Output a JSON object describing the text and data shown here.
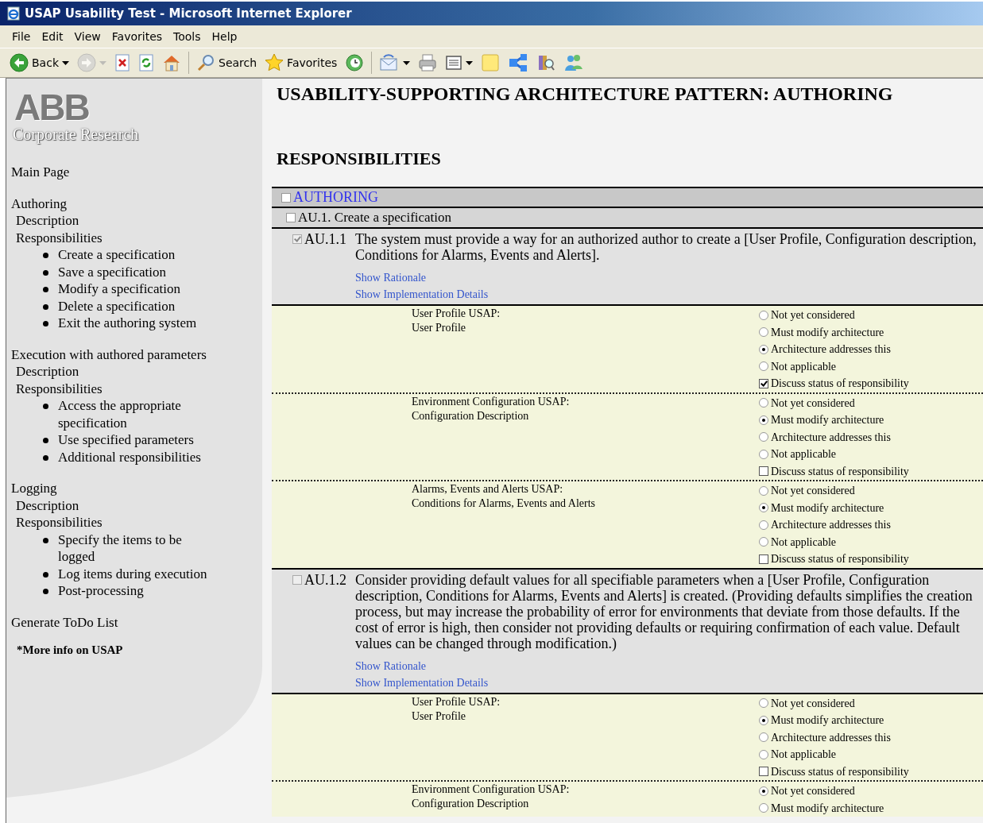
{
  "window": {
    "title": "USAP Usability Test - Microsoft Internet Explorer"
  },
  "menu": [
    "File",
    "Edit",
    "View",
    "Favorites",
    "Tools",
    "Help"
  ],
  "toolbar": [
    {
      "kind": "back",
      "label": "Back",
      "dropdown": true,
      "disabled": false
    },
    {
      "kind": "forward",
      "dropdown": true,
      "disabled": true
    },
    {
      "kind": "stop",
      "dropdown": false,
      "disabled": false
    },
    {
      "kind": "refresh",
      "dropdown": false,
      "disabled": false
    },
    {
      "kind": "home",
      "dropdown": false,
      "disabled": false
    },
    {
      "kind": "search",
      "label": "Search",
      "dropdown": false,
      "disabled": false
    },
    {
      "kind": "favorites",
      "label": "Favorites",
      "dropdown": false,
      "disabled": false
    },
    {
      "kind": "history",
      "dropdown": false,
      "disabled": false
    },
    {
      "kind": "mail",
      "dropdown": true,
      "disabled": false
    },
    {
      "kind": "print",
      "dropdown": false,
      "disabled": false
    },
    {
      "kind": "edit",
      "dropdown": true,
      "disabled": false
    },
    {
      "kind": "notes",
      "dropdown": false,
      "disabled": false
    },
    {
      "kind": "share",
      "dropdown": false,
      "disabled": false
    },
    {
      "kind": "research",
      "dropdown": false,
      "disabled": false
    },
    {
      "kind": "messenger",
      "dropdown": false,
      "disabled": false
    }
  ],
  "sidebar": {
    "logo": "ABB",
    "logo_subtitle": "Corporate Research",
    "main_link": "Main Page",
    "sections": [
      {
        "title": "Authoring",
        "links": [
          "Description",
          "Responsibilities"
        ],
        "items": [
          "Create a specification",
          "Save a specification",
          "Modify a specification",
          "Delete a specification",
          "Exit the authoring system"
        ]
      },
      {
        "title": "Execution with authored parameters",
        "links": [
          "Description",
          "Responsibilities"
        ],
        "items": [
          "Access the appropriate specification",
          "Use specified parameters",
          "Additional responsibilities"
        ]
      },
      {
        "title": "Logging",
        "links": [
          "Description",
          "Responsibilities"
        ],
        "items": [
          "Specify the items to be logged",
          "Log items during execution",
          "Post-processing"
        ]
      }
    ],
    "todo_link": "Generate ToDo List",
    "more_info": "*More info on USAP"
  },
  "main": {
    "title": "USABILITY-SUPPORTING ARCHITECTURE PATTERN: AUTHORING",
    "heading": "RESPONSIBILITIES",
    "category": {
      "label": "AUTHORING",
      "checked": false
    },
    "group": {
      "label": "AU.1. Create a specification",
      "checked": false
    },
    "responsibilities": [
      {
        "id": "AU.1.1",
        "text": "The system must provide a way for an authorized author to create a [User Profile, Configuration description, Conditions for Alarms, Events and Alerts].",
        "checked": true,
        "links": [
          "Show Rationale",
          "Show Implementation Details"
        ],
        "usaps": [
          {
            "title": "User Profile USAP:",
            "subtitle": "User Profile",
            "options": [
              {
                "label": "Not yet considered",
                "selected": false
              },
              {
                "label": "Must modify architecture",
                "selected": false
              },
              {
                "label": "Architecture addresses this",
                "selected": true
              },
              {
                "label": "Not applicable",
                "selected": false
              }
            ],
            "discuss": {
              "label": "Discuss status of responsibility",
              "checked": true
            }
          },
          {
            "title": "Environment Configuration USAP:",
            "subtitle": "Configuration Description",
            "options": [
              {
                "label": "Not yet considered",
                "selected": false
              },
              {
                "label": "Must modify architecture",
                "selected": true
              },
              {
                "label": "Architecture addresses this",
                "selected": false
              },
              {
                "label": "Not applicable",
                "selected": false
              }
            ],
            "discuss": {
              "label": "Discuss status of responsibility",
              "checked": false
            }
          },
          {
            "title": "Alarms, Events and Alerts USAP:",
            "subtitle": "Conditions for Alarms, Events and Alerts",
            "options": [
              {
                "label": "Not yet considered",
                "selected": false
              },
              {
                "label": "Must modify architecture",
                "selected": true
              },
              {
                "label": "Architecture addresses this",
                "selected": false
              },
              {
                "label": "Not applicable",
                "selected": false
              }
            ],
            "discuss": {
              "label": "Discuss status of responsibility",
              "checked": false
            }
          }
        ]
      },
      {
        "id": "AU.1.2",
        "text": "Consider providing default values for all specifiable parameters when a [User Profile, Configuration description, Conditions for Alarms, Events and Alerts] is created. (Providing defaults simplifies the creation process, but may increase the probability of error for environments that deviate from those defaults. If the cost of error is high, then consider not providing defaults or requiring confirmation of each value. Default values can be changed through modification.)",
        "checked": false,
        "links": [
          "Show Rationale",
          "Show Implementation Details"
        ],
        "usaps": [
          {
            "title": "User Profile USAP:",
            "subtitle": "User Profile",
            "options": [
              {
                "label": "Not yet considered",
                "selected": false
              },
              {
                "label": "Must modify architecture",
                "selected": true
              },
              {
                "label": "Architecture addresses this",
                "selected": false
              },
              {
                "label": "Not applicable",
                "selected": false
              }
            ],
            "discuss": {
              "label": "Discuss status of responsibility",
              "checked": false
            }
          },
          {
            "title": "Environment Configuration USAP:",
            "subtitle": "Configuration Description",
            "options": [
              {
                "label": "Not yet considered",
                "selected": true
              },
              {
                "label": "Must modify architecture",
                "selected": false
              }
            ]
          }
        ]
      }
    ]
  }
}
